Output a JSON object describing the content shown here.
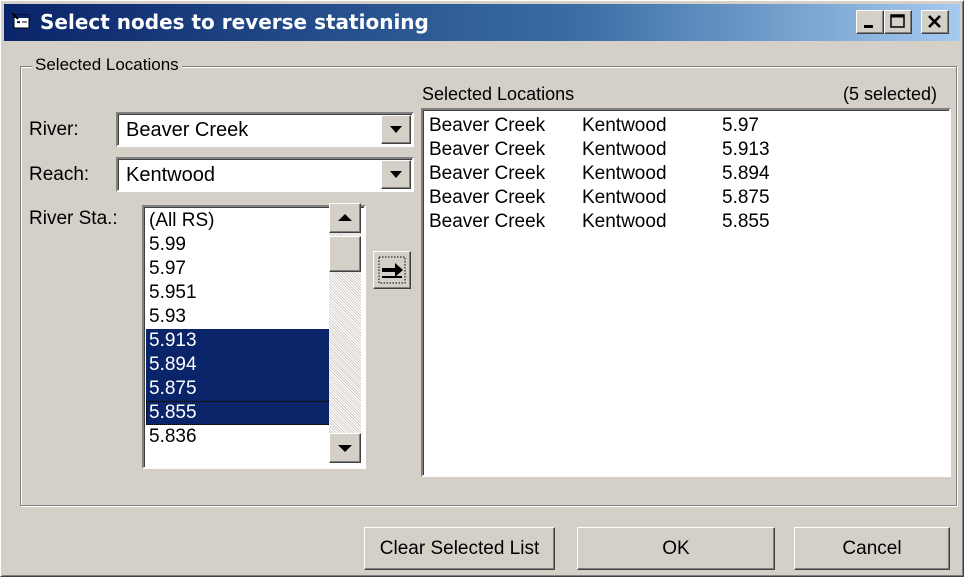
{
  "window": {
    "title": "Select nodes to reverse stationing"
  },
  "group": {
    "legend": "Selected Locations"
  },
  "river": {
    "label": "River:",
    "value": "Beaver Creek"
  },
  "reach": {
    "label": "Reach:",
    "value": "Kentwood"
  },
  "river_station": {
    "label": "River Sta.:",
    "items": [
      {
        "text": "(All RS)",
        "selected": false
      },
      {
        "text": "5.99",
        "selected": false
      },
      {
        "text": "5.97",
        "selected": false
      },
      {
        "text": "5.951",
        "selected": false
      },
      {
        "text": "5.93",
        "selected": false
      },
      {
        "text": "5.913",
        "selected": true
      },
      {
        "text": "5.894",
        "selected": true
      },
      {
        "text": "5.875",
        "selected": true
      },
      {
        "text": "5.855",
        "selected": true
      },
      {
        "text": "5.836",
        "selected": false
      }
    ]
  },
  "selected_locations": {
    "header": "Selected Locations",
    "count_text": "(5 selected)",
    "rows": [
      {
        "river": "Beaver Creek",
        "reach": "Kentwood",
        "rs": "5.97"
      },
      {
        "river": "Beaver Creek",
        "reach": "Kentwood",
        "rs": "5.913"
      },
      {
        "river": "Beaver Creek",
        "reach": "Kentwood",
        "rs": "5.894"
      },
      {
        "river": "Beaver Creek",
        "reach": "Kentwood",
        "rs": "5.875"
      },
      {
        "river": "Beaver Creek",
        "reach": "Kentwood",
        "rs": "5.855"
      }
    ]
  },
  "buttons": {
    "clear": "Clear Selected List",
    "ok": "OK",
    "cancel": "Cancel"
  },
  "icons": {
    "window": "dialog-window-icon",
    "minimize": "minimize-icon",
    "maximize": "maximize-icon",
    "close": "close-icon",
    "dropdown": "chevron-down-icon",
    "scroll_up": "scroll-up-arrow-icon",
    "scroll_down": "scroll-down-arrow-icon",
    "add": "arrow-right-icon"
  },
  "colors": {
    "title_gradient_start": "#0a246a",
    "title_gradient_end": "#a6caf0",
    "selection": "#0a246a",
    "face": "#d4d0c8"
  }
}
